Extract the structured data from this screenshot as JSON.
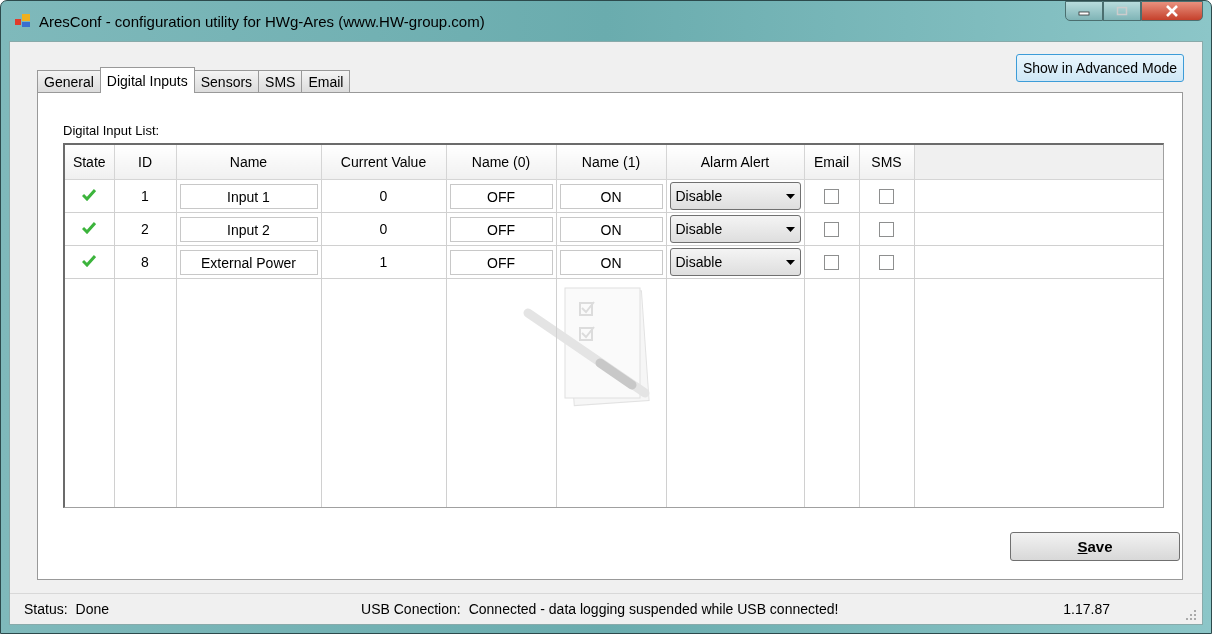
{
  "window": {
    "title": "AresConf - configuration utility for HWg-Ares (www.HW-group.com)"
  },
  "tabs": [
    {
      "label": "General",
      "selected": false
    },
    {
      "label": "Digital Inputs",
      "selected": true
    },
    {
      "label": "Sensors",
      "selected": false
    },
    {
      "label": "SMS",
      "selected": false
    },
    {
      "label": "Email",
      "selected": false
    }
  ],
  "advanced_button": "Show in Advanced Mode",
  "list_label": "Digital Input List:",
  "table": {
    "columns": [
      "State",
      "ID",
      "Name",
      "Current Value",
      "Name (0)",
      "Name (1)",
      "Alarm Alert",
      "Email",
      "SMS"
    ],
    "rows": [
      {
        "ok": true,
        "id": "1",
        "name": "Input 1",
        "current_value": "0",
        "name_0": "OFF",
        "name_1": "ON",
        "alarm_alert": "Disable",
        "email": false,
        "sms": false
      },
      {
        "ok": true,
        "id": "2",
        "name": "Input 2",
        "current_value": "0",
        "name_0": "OFF",
        "name_1": "ON",
        "alarm_alert": "Disable",
        "email": false,
        "sms": false
      },
      {
        "ok": true,
        "id": "8",
        "name": "External Power",
        "current_value": "1",
        "name_0": "OFF",
        "name_1": "ON",
        "alarm_alert": "Disable",
        "email": false,
        "sms": false
      }
    ]
  },
  "save_button": "Save",
  "status_bar": {
    "status_label": "Status:",
    "status": "Done",
    "usb_label": "USB Conection:",
    "usb_value": "Connected - data logging suspended while USB connected!",
    "version": "1.17.87"
  }
}
